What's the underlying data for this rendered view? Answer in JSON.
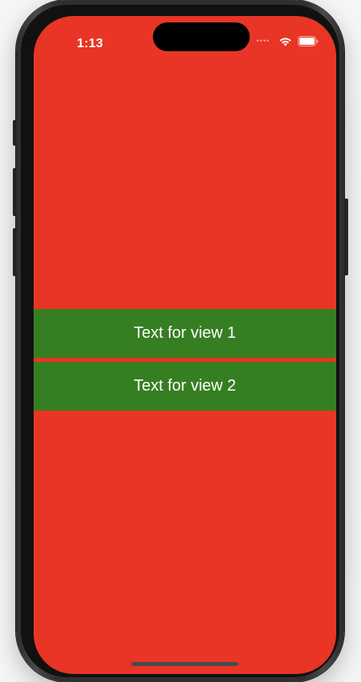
{
  "status_bar": {
    "time": "1:13",
    "icons": [
      "signal-dots-icon",
      "wifi-icon",
      "battery-icon"
    ]
  },
  "colors": {
    "background": "#e83525",
    "band": "#367e22",
    "text": "#ffffff"
  },
  "views": [
    {
      "label": "Text for view 1"
    },
    {
      "label": "Text for view 2"
    }
  ]
}
